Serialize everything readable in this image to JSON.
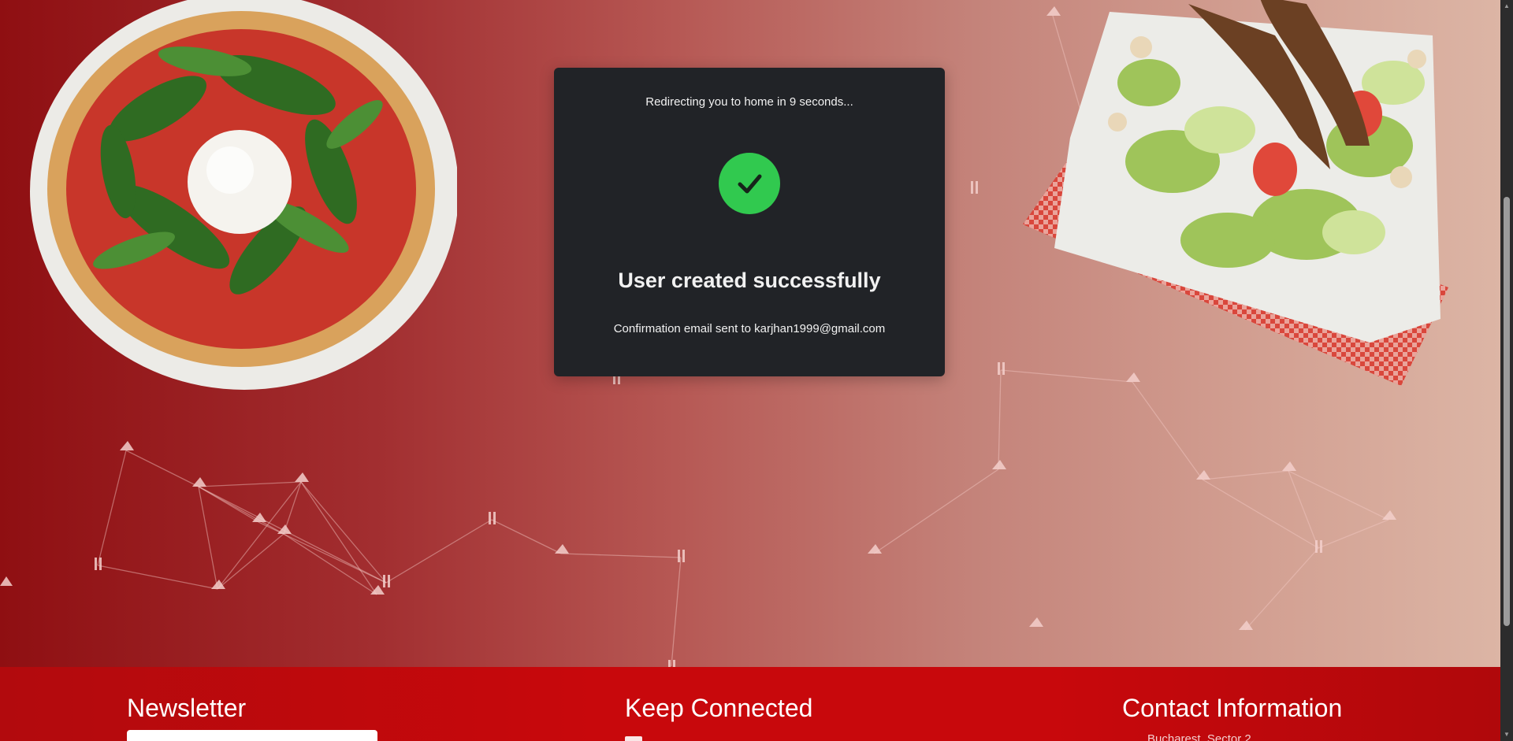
{
  "modal": {
    "redirect_text": "Redirecting you to home in 9 seconds...",
    "title": "User created successfully",
    "email_text": "Confirmation email sent to karjhan1999@gmail.com",
    "check_color": "#31c94f"
  },
  "footer": {
    "newsletter_title": "Newsletter",
    "keep_connected_title": "Keep Connected",
    "contact_title": "Contact Information",
    "contact_line": "Bucharest, Sector 2"
  },
  "colors": {
    "hero_left": "#8f0f12",
    "hero_right": "#dcb5a5",
    "modal_bg": "#212327",
    "footer_bg": "#c8080c"
  },
  "icons": [
    "pizza-slice-icon",
    "cutlery-icon",
    "check-icon",
    "scroll-up-icon",
    "scroll-down-icon"
  ]
}
